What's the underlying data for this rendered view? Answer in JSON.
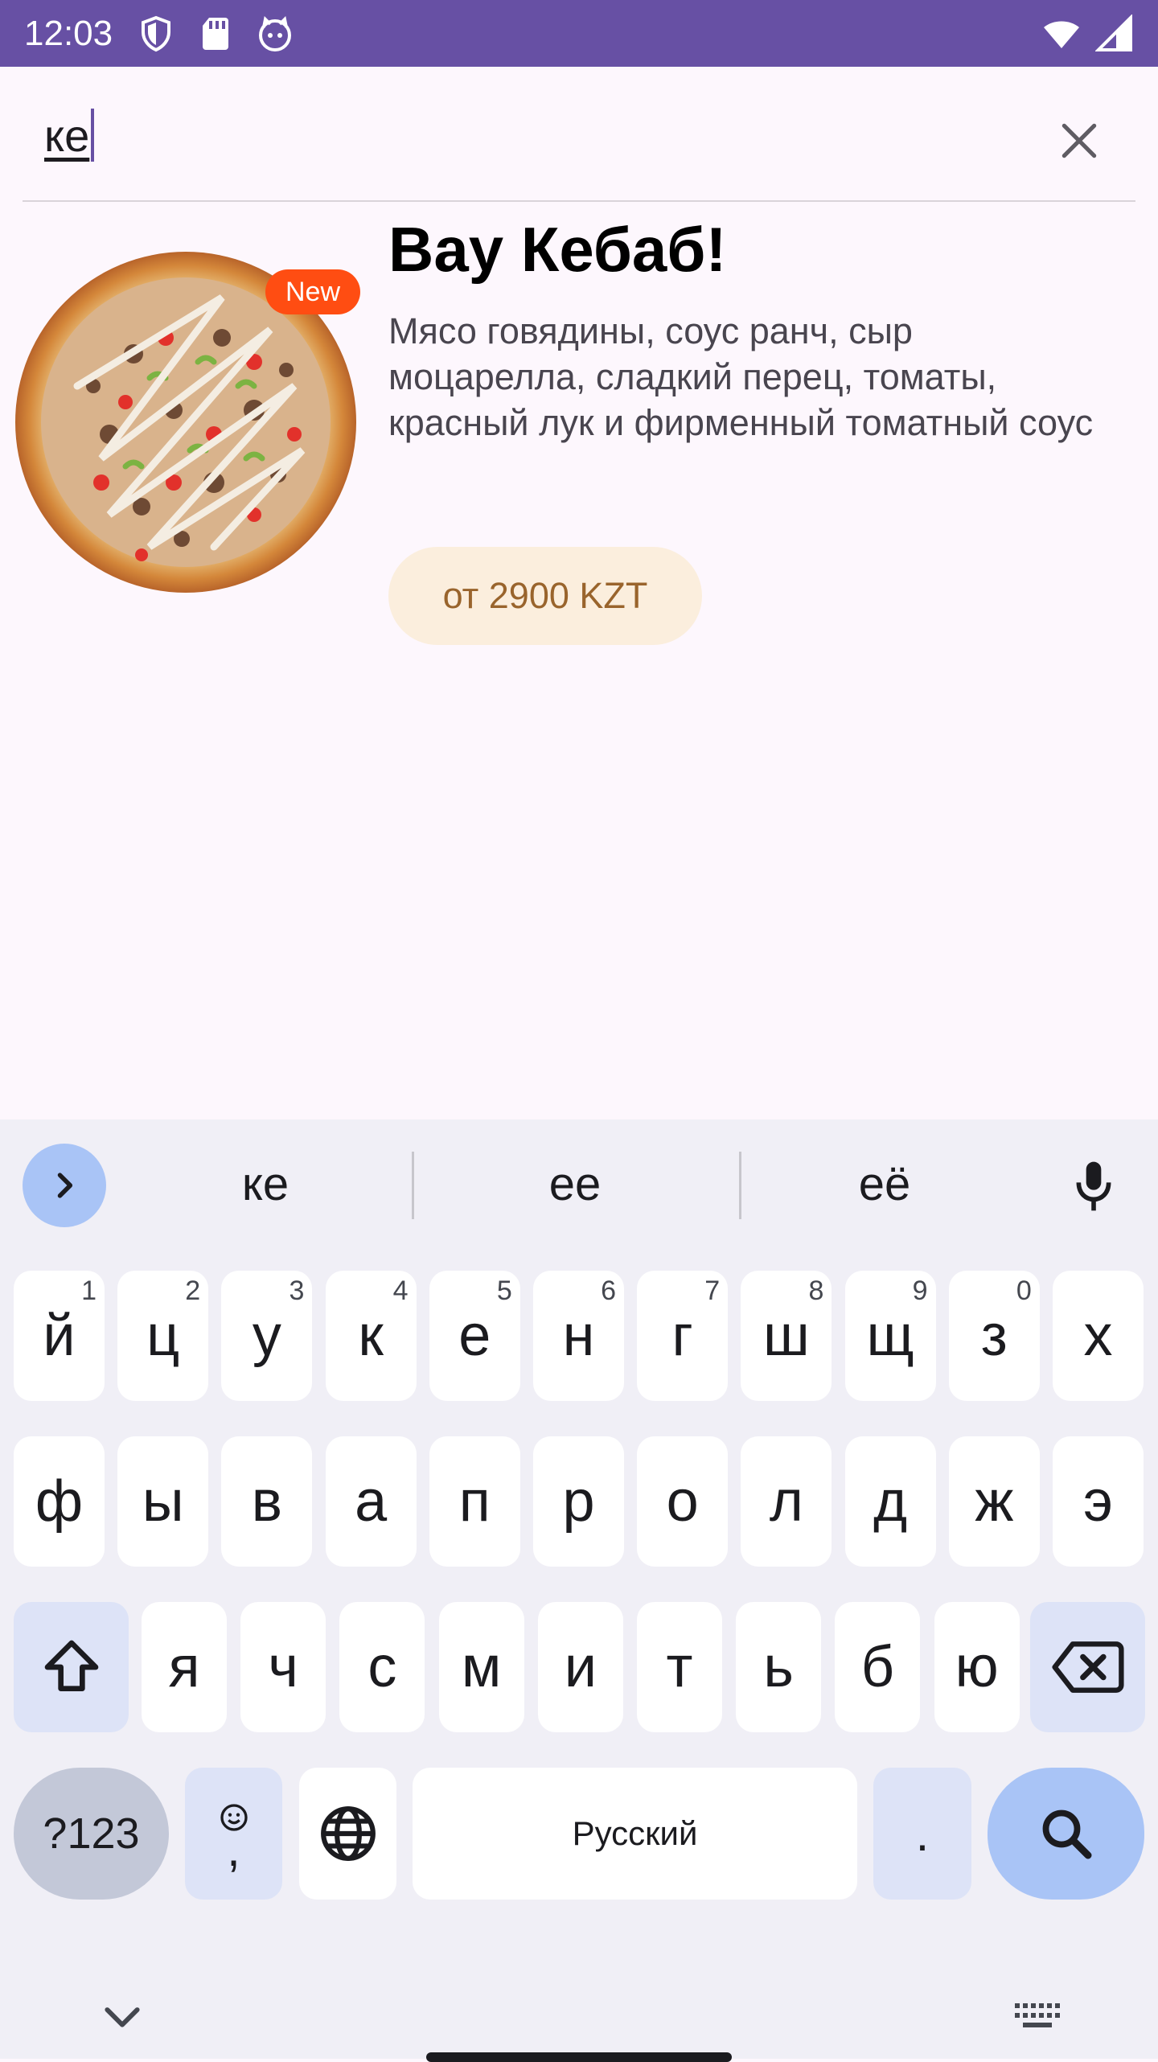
{
  "status_bar": {
    "time": "12:03",
    "icons_left": [
      "shield-icon",
      "sd-card-icon",
      "cat-face-icon"
    ],
    "icons_right": [
      "wifi-icon",
      "signal-icon"
    ]
  },
  "search": {
    "value": "ке",
    "clear_icon": "close-icon"
  },
  "product": {
    "badge": "New",
    "title": "Вау Кебаб!",
    "description": "Мясо говядины, соус ранч, сыр моцарелла, сладкий перец, томаты, красный лук и фирменный томатный соус",
    "price": "от 2900 KZT"
  },
  "keyboard": {
    "suggestions": [
      "ке",
      "ее",
      "её"
    ],
    "row1": [
      {
        "label": "й",
        "hint": "1"
      },
      {
        "label": "ц",
        "hint": "2"
      },
      {
        "label": "у",
        "hint": "3"
      },
      {
        "label": "к",
        "hint": "4"
      },
      {
        "label": "е",
        "hint": "5"
      },
      {
        "label": "н",
        "hint": "6"
      },
      {
        "label": "г",
        "hint": "7"
      },
      {
        "label": "ш",
        "hint": "8"
      },
      {
        "label": "щ",
        "hint": "9"
      },
      {
        "label": "з",
        "hint": "0"
      },
      {
        "label": "х",
        "hint": ""
      }
    ],
    "row2": [
      "ф",
      "ы",
      "в",
      "а",
      "п",
      "р",
      "о",
      "л",
      "д",
      "ж",
      "э"
    ],
    "row3": [
      "я",
      "ч",
      "с",
      "м",
      "и",
      "т",
      "ь",
      "б",
      "ю"
    ],
    "symbols_label": "?123",
    "comma_label": ",",
    "space_label": "Русский",
    "period_label": ".",
    "colors": {
      "accent": "#a9c4f6",
      "modifier": "#dde3f7",
      "background": "#f0eff6"
    }
  },
  "colors": {
    "status_bar": "#6750a4",
    "badge": "#ff4d12",
    "price_bg": "#fbeedd",
    "price_text": "#99642c"
  }
}
